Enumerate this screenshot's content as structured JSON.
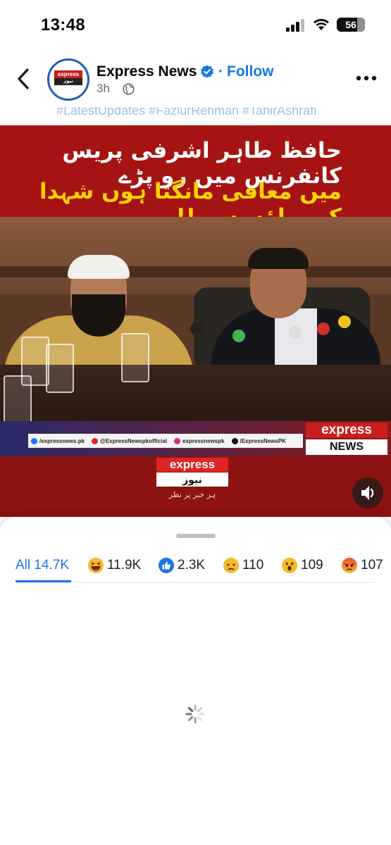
{
  "status_bar": {
    "time": "13:48",
    "battery": "56"
  },
  "post": {
    "page_name": "Express News",
    "follow_label": "Follow",
    "separator": "·",
    "time_ago": "3h",
    "avatar_logo_top": "express",
    "avatar_logo_bottom": "نیوز",
    "hashtags": "#LatestUpdates #FazlurRehman #TahirAshrafi"
  },
  "video": {
    "headline_line1": "حافظ طاہر اشرفی پریس کانفرنس میں رو پڑے",
    "headline_line2": "میں معافی مانگتا ہوں شہدا کی ماؤں سے !!",
    "social": [
      {
        "label": "/expressnews.pk",
        "color": "#1877f2"
      },
      {
        "label": "@ExpressNewspkofficial",
        "color": "#e02424"
      },
      {
        "label": "expressnewspk",
        "color": "#c13584"
      },
      {
        "label": "/ExpressNewsPK",
        "color": "#111111"
      }
    ],
    "brand_top": "express",
    "brand_bottom": "NEWS",
    "lower_logo_top": "express",
    "lower_logo_bottom": "نیوز",
    "lower_logo_sub": "ہر خبر پر نظر"
  },
  "reactions": {
    "tabs": [
      {
        "label": "All 14.7K",
        "icon": "",
        "active": true
      },
      {
        "label": "11.9K",
        "icon": "haha-icon"
      },
      {
        "label": "2.3K",
        "icon": "like-icon"
      },
      {
        "label": "110",
        "icon": "sad-icon"
      },
      {
        "label": "109",
        "icon": "wow-icon"
      },
      {
        "label": "107",
        "icon": "angry-icon"
      }
    ]
  },
  "colors": {
    "accent": "#1b74e4",
    "brand_red": "#c81e1e"
  }
}
